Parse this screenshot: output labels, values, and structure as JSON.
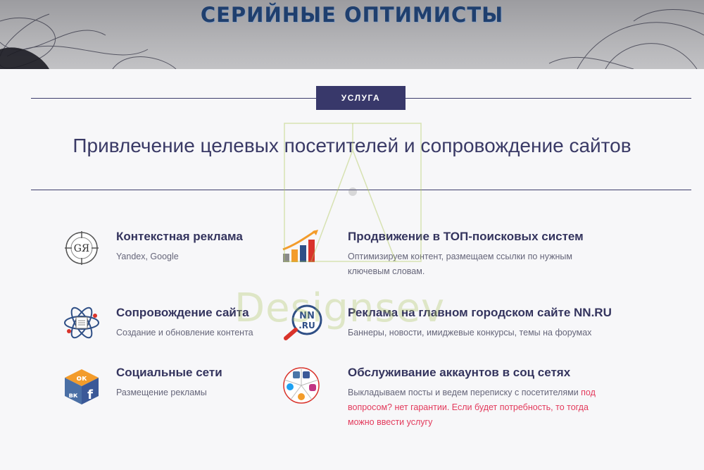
{
  "hero": {
    "title": "СЕРИЙНЫЕ ОПТИМИСТЫ"
  },
  "badge": {
    "label": "УСЛУГА"
  },
  "headline": "Привлечение целевых посетителей и сопровождение сайтов",
  "services": [
    {
      "title": "Контекстная реклама",
      "desc": "Yandex, Google",
      "icon": "context-ads-icon"
    },
    {
      "title": "Продвижение в ТОП-поисковых систем",
      "desc": "Оптимизируем контент, размещаем ссылки по нужным ключевым словам.",
      "icon": "growth-chart-icon"
    },
    {
      "title": "Сопровождение сайта",
      "desc": "Создание и обновление контента",
      "icon": "site-support-icon"
    },
    {
      "title": "Реклама на главном городском сайте NN.RU",
      "desc": "Баннеры, новости, имиджевые конкурсы, темы на форумах",
      "icon": "nn-ru-icon"
    },
    {
      "title": "Социальные сети",
      "desc": "Размещение рекламы",
      "icon": "social-cube-icon"
    },
    {
      "title": "Обслуживание аккаунтов в соц сетях",
      "desc_plain": "Выкладываем посты и ведем переписку с посетителями ",
      "desc_red": "под вопросом? нет гарантии. Если будет потребность, то тогда можно ввести услугу",
      "icon": "social-accounts-icon"
    }
  ],
  "watermark": {
    "text": "Designsev"
  },
  "icon_labels": {
    "gya": "GЯ",
    "nn": "NN",
    "ru": ".RU",
    "ok": "ок",
    "vk": "вк",
    "fb": "f"
  },
  "colors": {
    "accent": "#38386a",
    "title": "#34345e",
    "red": "#e33a5c",
    "hero_title": "#1f3f6e"
  }
}
